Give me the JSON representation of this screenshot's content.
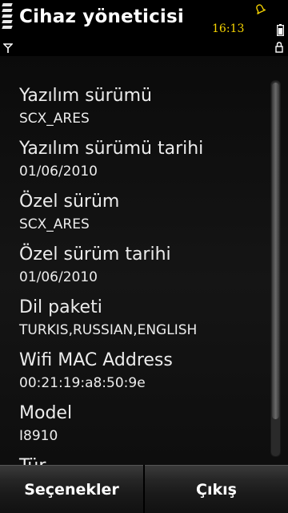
{
  "window": {
    "title": "Cihaz yöneticisi",
    "clock": "16:13"
  },
  "device_info": {
    "items": [
      {
        "label": "Yazılım sürümü",
        "value": "SCX_ARES"
      },
      {
        "label": "Yazılım sürümü tarihi",
        "value": "01/06/2010"
      },
      {
        "label": "Özel sürüm",
        "value": "SCX_ARES"
      },
      {
        "label": "Özel sürüm tarihi",
        "value": "01/06/2010"
      },
      {
        "label": "Dil paketi",
        "value": "TURKIS,RUSSIAN,ENGLISH"
      },
      {
        "label": "Wifi MAC Address",
        "value": "00:21:19:a8:50:9e"
      },
      {
        "label": "Model",
        "value": "I8910"
      },
      {
        "label": "Tür",
        "value": ""
      }
    ]
  },
  "softkeys": {
    "left_label": "Seçenekler",
    "right_label": "Çıkış"
  },
  "icons": {
    "app": "menu-app-icon",
    "alarm": "bell-icon",
    "battery": "battery-icon",
    "signal": "signal-antenna-icon",
    "keylock": "lock-icon"
  },
  "colors": {
    "background": "#000000",
    "text": "#ececec",
    "clock": "#f5d300",
    "alarm": "#f5d300"
  }
}
